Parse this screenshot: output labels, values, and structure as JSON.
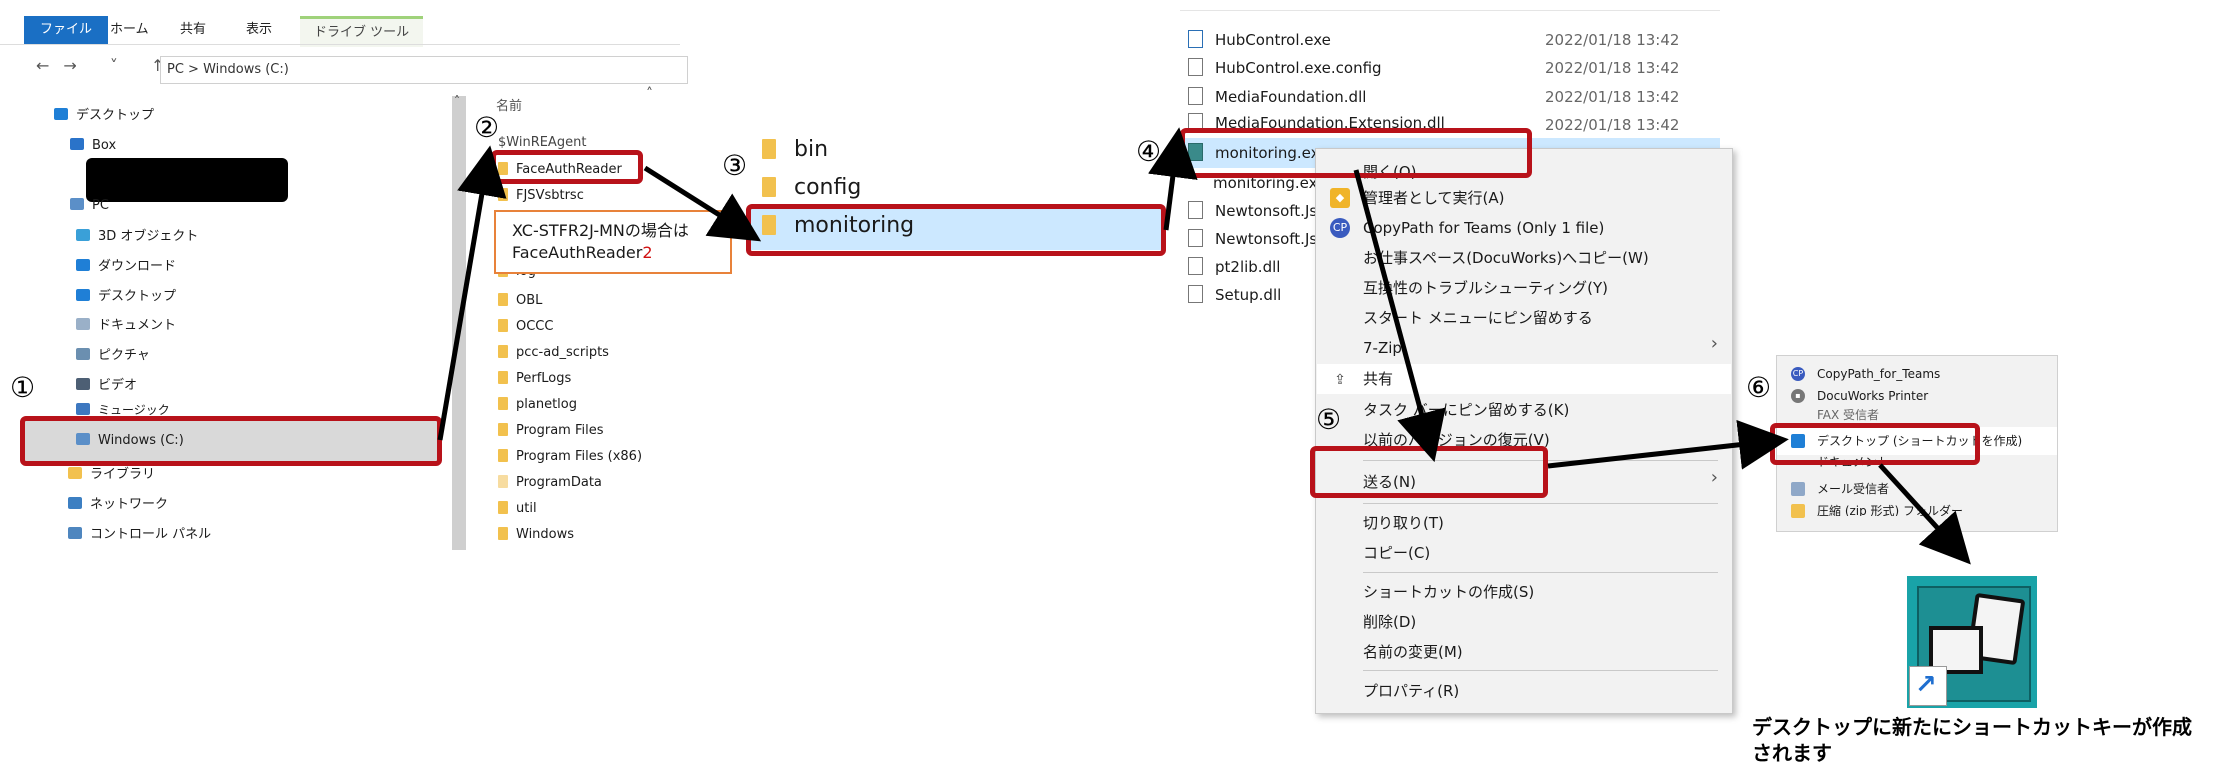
{
  "ribbon": {
    "tabs": [
      "ファイル",
      "ホーム",
      "共有",
      "表示"
    ],
    "drive_tools": "ドライブ ツール"
  },
  "address": {
    "path": "PC  >  Windows (C:)"
  },
  "nav_pane": [
    "デスクトップ",
    "Box",
    "",
    "PC",
    "3D オブジェクト",
    "ダウンロード",
    "デスクトップ",
    "ドキュメント",
    "ピクチャ",
    "ビデオ",
    "ミュージック",
    "Windows (C:)",
    "ライブラリ",
    "ネットワーク",
    "コントロール パネル"
  ],
  "folder_list": {
    "header": "名前",
    "items": [
      "$WinREAgent",
      "FaceAuthReader",
      "FJSVsbtrsc",
      "log",
      "OBL",
      "OCCC",
      "pcc-ad_scripts",
      "PerfLogs",
      "planetlog",
      "Program Files",
      "Program Files (x86)",
      "ProgramData",
      "util",
      "Windows"
    ]
  },
  "note": {
    "line1": "XC-STFR2J-MNの場合は",
    "line2_prefix": "FaceAuthReader",
    "line2_suffix": "2"
  },
  "faceauth_folders": [
    "bin",
    "config",
    "monitoring"
  ],
  "files": [
    {
      "name": "HubControl.exe",
      "date": "2022/01/18 13:42"
    },
    {
      "name": "HubControl.exe.config",
      "date": "2022/01/18 13:42"
    },
    {
      "name": "MediaFoundation.dll",
      "date": "2022/01/18 13:42"
    },
    {
      "name": "MediaFoundation.Extension.dll",
      "date": "2022/01/18 13:42"
    },
    {
      "name": "monitoring.exe",
      "date": "2022/01/18 13:42"
    },
    {
      "name": "monitoring.exe",
      "date": ""
    },
    {
      "name": "Newtonsoft.Js",
      "date": ""
    },
    {
      "name": "Newtonsoft.Js",
      "date": ""
    },
    {
      "name": "pt2lib.dll",
      "date": ""
    },
    {
      "name": "Setup.dll",
      "date": ""
    }
  ],
  "context_menu": [
    "開く(O)",
    "管理者として実行(A)",
    "CopyPath for Teams (Only 1 file)",
    "お仕事スペース(DocuWorks)へコピー(W)",
    "互換性のトラブルシューティング(Y)",
    "スタート メニューにピン留めする",
    "7-Zip",
    "共有",
    "タスク バーにピン留めする(K)",
    "以前のバージョンの復元(V)",
    "送る(N)",
    "切り取り(T)",
    "コピー(C)",
    "ショートカットの作成(S)",
    "削除(D)",
    "名前の変更(M)",
    "プロパティ(R)"
  ],
  "send_to_menu": [
    "CopyPath_for_Teams",
    "DocuWorks Printer",
    "FAX 受信者",
    "デスクトップ (ショートカットを作成)",
    "ドキュメント",
    "メール受信者",
    "圧縮 (zip 形式) フォルダー"
  ],
  "steps": [
    "①",
    "②",
    "③",
    "④",
    "⑤",
    "⑥"
  ],
  "caption": "デスクトップに新たにショートカットキーが作成されます",
  "colors": {
    "highlight_box": "#b8121a",
    "note_border": "#e8823a",
    "selection": "#cce8ff"
  }
}
